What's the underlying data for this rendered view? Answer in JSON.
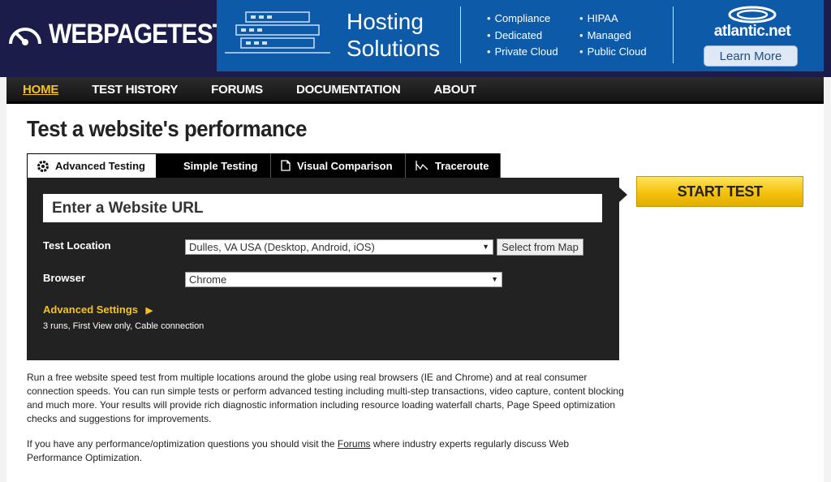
{
  "logo": {
    "text": "WEBPAGETEST"
  },
  "banner": {
    "title_line1": "Hosting",
    "title_line2": "Solutions",
    "bullets_col1": [
      "Compliance",
      "Dedicated",
      "Private Cloud"
    ],
    "bullets_col2": [
      "HIPAA",
      "Managed",
      "Public Cloud"
    ],
    "brand": "atlantic.net",
    "cta": "Learn More"
  },
  "nav": {
    "items": [
      "HOME",
      "TEST HISTORY",
      "FORUMS",
      "DOCUMENTATION",
      "ABOUT"
    ]
  },
  "page_title": "Test a website's performance",
  "tabs": [
    {
      "label": "Advanced Testing",
      "icon": "gear-icon"
    },
    {
      "label": "Simple Testing",
      "icon": ""
    },
    {
      "label": "Visual Comparison",
      "icon": "document-icon"
    },
    {
      "label": "Traceroute",
      "icon": "traceroute-icon"
    }
  ],
  "form": {
    "url_placeholder": "Enter a Website URL",
    "location_label": "Test Location",
    "location_value": "Dulles, VA USA (Desktop, Android, iOS)",
    "map_button": "Select from Map",
    "browser_label": "Browser",
    "browser_value": "Chrome",
    "advanced_settings": "Advanced Settings",
    "advanced_summary": "3 runs, First View only, Cable connection",
    "start_button": "START TEST"
  },
  "description": {
    "paragraph1": "Run a free website speed test from multiple locations around the globe using real browsers (IE and Chrome) and at real consumer connection speeds. You can run simple tests or perform advanced testing including multi-step transactions, video capture, content blocking and much more. Your results will provide rich diagnostic information including resource loading waterfall charts, Page Speed optimization checks and suggestions for improvements.",
    "paragraph2_before": "If you have any performance/optimization questions you should visit the ",
    "paragraph2_link": "Forums",
    "paragraph2_after": " where industry experts regularly discuss Web Performance Optimization."
  },
  "colors": {
    "header_bg": "#1c1c4a",
    "banner_bg": "#0d5aa8",
    "accent": "#f6c31a",
    "form_bg": "#222222"
  }
}
